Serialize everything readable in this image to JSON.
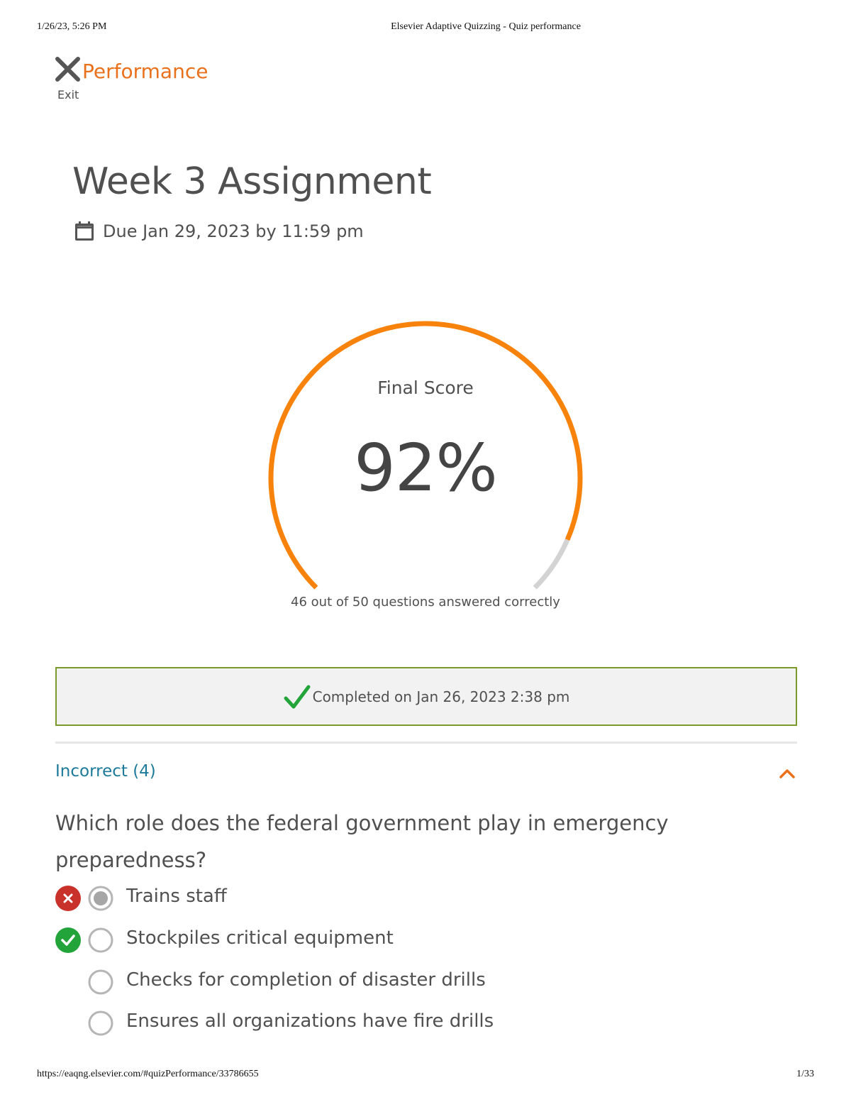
{
  "print_header": {
    "date": "1/26/23, 5:26 PM",
    "title": "Elsevier Adaptive Quizzing - Quiz performance"
  },
  "print_footer": {
    "url": "https://eaqng.elsevier.com/#quizPerformance/33786655",
    "page": "1/33"
  },
  "header": {
    "exit_label": "Exit",
    "title": "Performance",
    "accent_color": "#e9711c"
  },
  "assignment": {
    "title": "Week 3 Assignment",
    "due": "Due Jan 29, 2023 by 11:59 pm"
  },
  "score": {
    "label": "Final Score",
    "value": "92%",
    "fraction": 0.92,
    "answered": "46 out of 50 questions answered correctly",
    "progress_color": "#f7820c",
    "track_color": "#d3d3d3"
  },
  "completed": {
    "text": "Completed on Jan 26, 2023 2:38 pm",
    "border_color": "#7a9a2c"
  },
  "incorrect_section": {
    "title": "Incorrect (4)",
    "expanded": true,
    "title_color": "#1e7a9a"
  },
  "question": {
    "text": "Which role does the federal government play in emergency preparedness?",
    "options": [
      {
        "label": "Trains staff",
        "status": "incorrect",
        "selected": true
      },
      {
        "label": "Stockpiles critical equipment",
        "status": "correct",
        "selected": false
      },
      {
        "label": "Checks for completion of disaster drills",
        "status": "none",
        "selected": false
      },
      {
        "label": "Ensures all organizations have fire drills",
        "status": "none",
        "selected": false
      }
    ]
  }
}
